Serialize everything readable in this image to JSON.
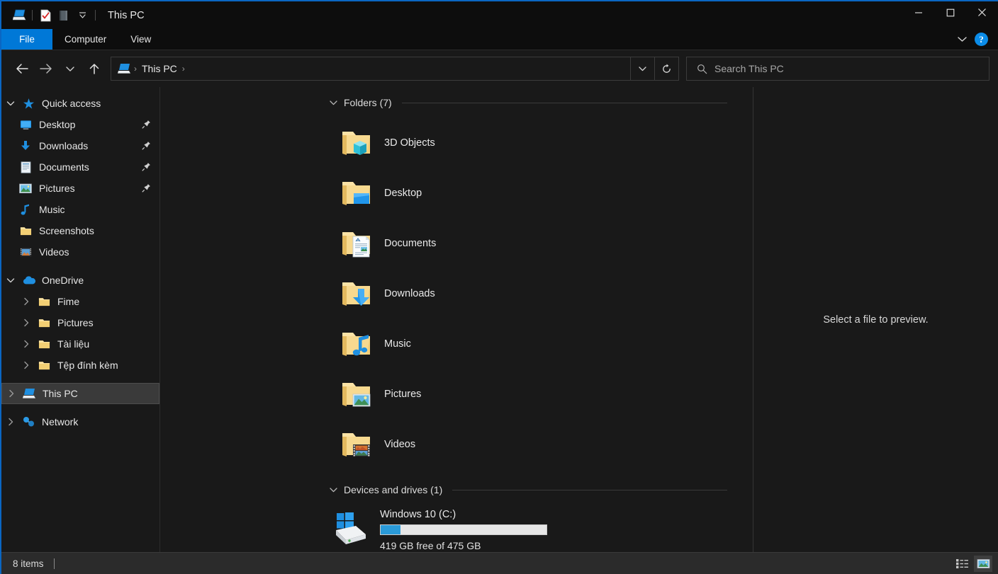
{
  "window": {
    "title": "This PC",
    "accent_color": "#0078d7",
    "bg_color": "#191919"
  },
  "titlebar": {
    "quick_access": [
      {
        "name": "this-pc-icon",
        "label": "This PC"
      },
      {
        "name": "properties-icon",
        "label": "Properties"
      },
      {
        "name": "new-folder-icon",
        "label": "New folder"
      },
      {
        "name": "customize-dropdown-icon",
        "label": "Customize Quick Access Toolbar"
      }
    ],
    "controls": {
      "minimize": "Minimize",
      "maximize": "Maximize",
      "close": "Close"
    }
  },
  "ribbon": {
    "tabs": [
      {
        "label": "File",
        "active": true
      },
      {
        "label": "Computer",
        "active": false
      },
      {
        "label": "View",
        "active": false
      }
    ],
    "expand_label": "Expand the Ribbon",
    "help_label": "?"
  },
  "addressbar": {
    "back": "Back",
    "forward": "Forward",
    "recent": "Recent locations",
    "up": "Up",
    "breadcrumb": {
      "icon": "this-pc-icon",
      "segments": [
        "This PC"
      ],
      "separator": "›"
    },
    "previous_locations": "Previous Locations",
    "refresh": "Refresh",
    "search": {
      "placeholder": "Search This PC",
      "value": ""
    }
  },
  "sidebar": {
    "groups": [
      {
        "name": "quick-access",
        "label": "Quick access",
        "icon": "star-icon",
        "expanded": true,
        "chevron": "down",
        "items": [
          {
            "label": "Desktop",
            "icon": "desktop-icon",
            "pinned": true,
            "chevron": ""
          },
          {
            "label": "Downloads",
            "icon": "downloads-icon",
            "pinned": true,
            "chevron": ""
          },
          {
            "label": "Documents",
            "icon": "documents-icon",
            "pinned": true,
            "chevron": ""
          },
          {
            "label": "Pictures",
            "icon": "pictures-icon",
            "pinned": true,
            "chevron": ""
          },
          {
            "label": "Music",
            "icon": "music-note-icon",
            "pinned": false,
            "chevron": ""
          },
          {
            "label": "Screenshots",
            "icon": "folder-icon",
            "pinned": false,
            "chevron": ""
          },
          {
            "label": "Videos",
            "icon": "videos-icon",
            "pinned": false,
            "chevron": ""
          }
        ]
      },
      {
        "name": "onedrive",
        "label": "OneDrive",
        "icon": "onedrive-cloud-icon",
        "expanded": true,
        "chevron": "down",
        "items": [
          {
            "label": "Fime",
            "icon": "folder-icon",
            "pinned": false,
            "chevron": "right"
          },
          {
            "label": "Pictures",
            "icon": "folder-icon",
            "pinned": false,
            "chevron": "right"
          },
          {
            "label": "Tài liệu",
            "icon": "folder-icon",
            "pinned": false,
            "chevron": "right"
          },
          {
            "label": "Tệp đính kèm",
            "icon": "folder-icon",
            "pinned": false,
            "chevron": "right"
          }
        ]
      }
    ],
    "roots": [
      {
        "label": "This PC",
        "icon": "this-pc-icon",
        "chevron": "right",
        "selected": true
      },
      {
        "label": "Network",
        "icon": "network-icon",
        "chevron": "right",
        "selected": false
      }
    ]
  },
  "main": {
    "folders_section": {
      "title": "Folders (7)",
      "chevron": "down",
      "items": [
        {
          "label": "3D Objects",
          "icon": "folder-3d-objects-icon"
        },
        {
          "label": "Desktop",
          "icon": "folder-desktop-icon"
        },
        {
          "label": "Documents",
          "icon": "folder-documents-icon"
        },
        {
          "label": "Downloads",
          "icon": "folder-downloads-icon"
        },
        {
          "label": "Music",
          "icon": "folder-music-icon"
        },
        {
          "label": "Pictures",
          "icon": "folder-pictures-icon"
        },
        {
          "label": "Videos",
          "icon": "folder-videos-icon"
        }
      ]
    },
    "drives_section": {
      "title": "Devices and drives (1)",
      "chevron": "down",
      "items": [
        {
          "label": "Windows 10 (C:)",
          "icon": "windows-drive-icon",
          "free_text": "419 GB free of 475 GB",
          "used_percent": 12,
          "bar_fill_color": "#2a9ad8",
          "bar_track_color": "#e6e6e6"
        }
      ]
    }
  },
  "preview_pane": {
    "message": "Select a file to preview."
  },
  "statusbar": {
    "item_count": "8 items",
    "views": [
      {
        "name": "details-view-button",
        "label": "Details view",
        "active": false
      },
      {
        "name": "large-icons-view-button",
        "label": "Large icons view",
        "active": true
      }
    ]
  }
}
